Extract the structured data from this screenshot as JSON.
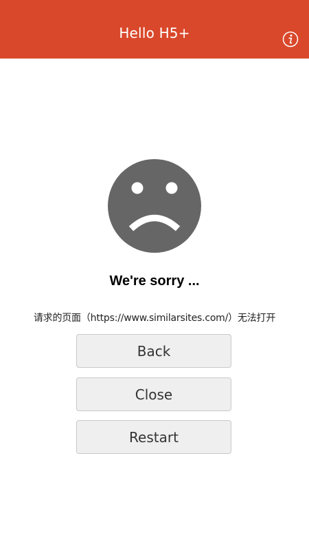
{
  "header": {
    "title": "Hello H5+",
    "icon": "info-icon"
  },
  "error": {
    "icon": "sad-face-icon",
    "heading": "We're sorry ...",
    "message": "请求的页面（https://www.similarsites.com/）无法打开"
  },
  "buttons": {
    "back": "Back",
    "close": "Close",
    "restart": "Restart"
  },
  "colors": {
    "header_bg": "#d9482b",
    "face": "#666666",
    "button_bg": "#efefef",
    "page_bg": "#ffffff"
  }
}
